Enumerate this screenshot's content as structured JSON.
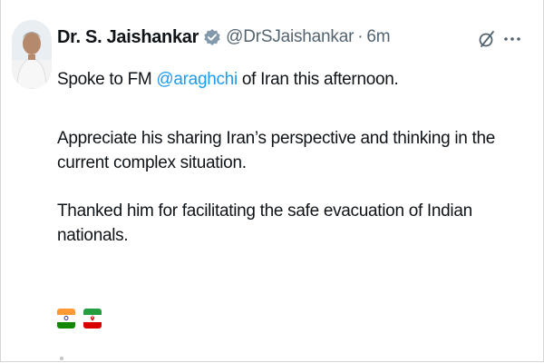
{
  "post": {
    "display_name": "Dr. S. Jaishankar",
    "handle": "@DrSJaishankar",
    "separator": "·",
    "time": "6m",
    "line1": {
      "before": "Spoke to FM ",
      "mention": "@araghchi",
      "after": " of Iran this afternoon."
    },
    "paragraph2": "Appreciate his sharing Iran’s perspective and thinking in the current complex situation.",
    "paragraph3": "Thanked him for facilitating the safe evacuation of Indian nationals.",
    "flags": [
      "India flag",
      "Iran flag"
    ]
  },
  "icons": {
    "verified": "verified-badge-icon",
    "grok": "grok-icon",
    "more": "more-options-icon"
  },
  "colors": {
    "text": "#0f1419",
    "secondary": "#536471",
    "mention": "#1d9bf0",
    "verified_badge": "#829aab"
  }
}
